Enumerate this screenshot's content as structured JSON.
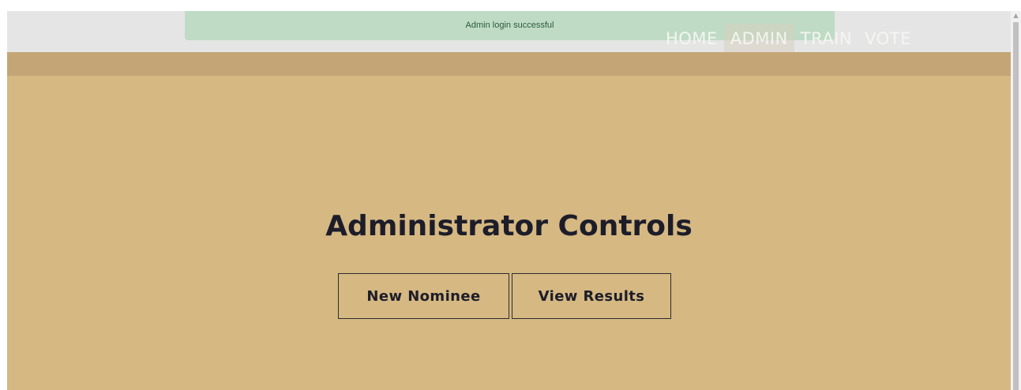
{
  "alert": {
    "message": "Admin login successful"
  },
  "nav": {
    "items": [
      {
        "label": "HOME",
        "active": false
      },
      {
        "label": "ADMIN",
        "active": true
      },
      {
        "label": "TRAIN",
        "active": false
      },
      {
        "label": "VOTE",
        "active": false
      }
    ]
  },
  "main": {
    "title": "Administrator Controls",
    "buttons": {
      "new_nominee": "New Nominee",
      "view_results": "View Results"
    }
  },
  "scrollbar": {
    "up_arrow_icon": "triangle-up"
  },
  "colors": {
    "page_background": "#d5b882",
    "navbar_background": "#c4a676",
    "alert_background": "#bfdbc5",
    "alert_text": "#2c5b3a",
    "heading_text": "#1d1d2a"
  }
}
